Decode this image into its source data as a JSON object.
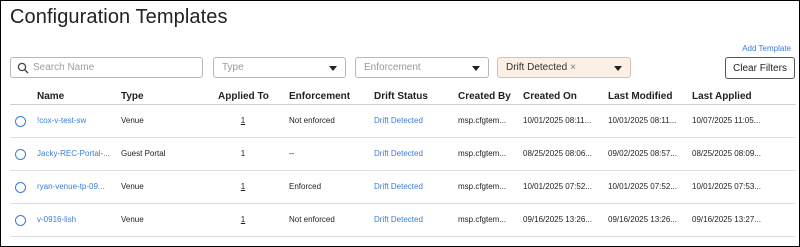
{
  "page": {
    "title": "Configuration Templates",
    "add_link": "Add Template"
  },
  "filters": {
    "search_placeholder": "Search Name",
    "type_placeholder": "Type",
    "enforcement_placeholder": "Enforcement",
    "drift_value": "Drift Detected",
    "clear_label": "Clear Filters"
  },
  "table": {
    "columns": [
      "Name",
      "Type",
      "Applied To",
      "Enforcement",
      "Drift Status",
      "Created By",
      "Created On",
      "Last Modified",
      "Last Applied"
    ],
    "rows": [
      {
        "name": "!cox-v-test-sw",
        "type": "Venue",
        "applied_to": "1",
        "enforcement": "Not enforced",
        "drift": "Drift Detected",
        "created_by": "msp.cfgtem...",
        "created_on": "10/01/2025 08:11...",
        "last_modified": "10/01/2025 08:11...",
        "last_applied": "10/07/2025 11:05..."
      },
      {
        "name": "Jacky-REC-Portal-...",
        "type": "Guest Portal",
        "applied_to": "1",
        "enforcement": "--",
        "drift": "Drift Detected",
        "created_by": "msp.cfgtem...",
        "created_on": "08/25/2025 08:06...",
        "last_modified": "09/02/2025 08:57...",
        "last_applied": "08/25/2025 08:09..."
      },
      {
        "name": "ryan-venue-tp-09...",
        "type": "Venue",
        "applied_to": "1",
        "enforcement": "Enforced",
        "drift": "Drift Detected",
        "created_by": "msp.cfgtem...",
        "created_on": "10/01/2025 07:52...",
        "last_modified": "10/01/2025 07:52...",
        "last_applied": "10/01/2025 07:53..."
      },
      {
        "name": "v-0916-lish",
        "type": "Venue",
        "applied_to": "1",
        "enforcement": "Not enforced",
        "drift": "Drift Detected",
        "created_by": "msp.cfgtem...",
        "created_on": "09/16/2025 13:26...",
        "last_modified": "09/16/2025 13:26...",
        "last_applied": "09/16/2025 13:27..."
      }
    ]
  },
  "colors": {
    "link": "#3b7dd8",
    "drift_chip_bg": "#fcefe6"
  },
  "icons": {
    "search": "search-icon",
    "caret": "caret-down-icon",
    "radio": "radio-unselected-icon",
    "clear": "close-icon"
  }
}
